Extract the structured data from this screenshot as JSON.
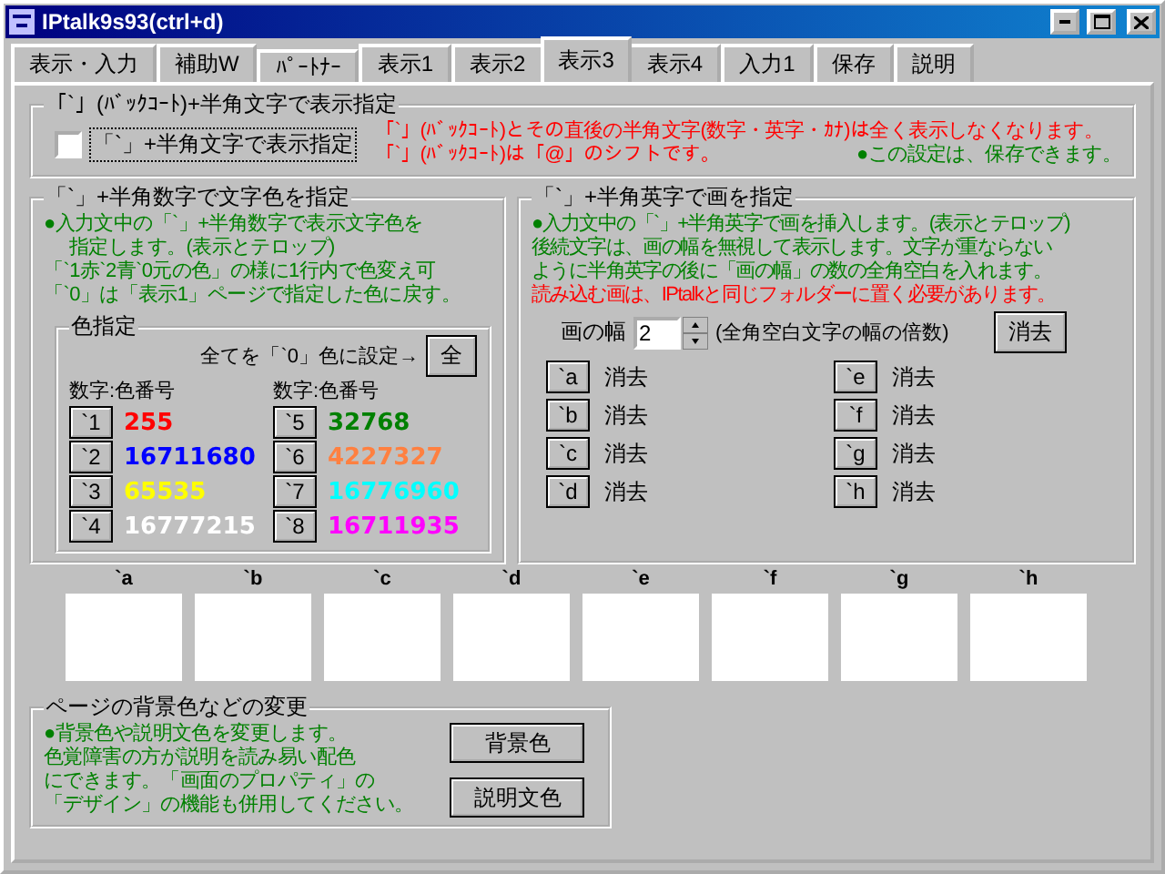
{
  "window": {
    "title": "IPtalk9s93(ctrl+d)"
  },
  "tabs": [
    {
      "label": "表示・入力",
      "selected": false
    },
    {
      "label": "補助W",
      "selected": false
    },
    {
      "label": "ﾊﾟｰﾄﾅｰ",
      "selected": false
    },
    {
      "label": "表示1",
      "selected": false
    },
    {
      "label": "表示2",
      "selected": false
    },
    {
      "label": "表示3",
      "selected": true
    },
    {
      "label": "表示4",
      "selected": false
    },
    {
      "label": "入力1",
      "selected": false
    },
    {
      "label": "保存",
      "selected": false
    },
    {
      "label": "説明",
      "selected": false
    }
  ],
  "display_group": {
    "title": "「`」(ﾊﾞｯｸｺｰﾄ)+半角文字で表示指定",
    "checkbox": {
      "label": "「`」+半角文字で表示指定",
      "checked": false
    },
    "notes": [
      {
        "text": "「`」(ﾊﾞｯｸｺｰﾄ)とその直後の半角文字(数字・英字・ｶﾅ)は全く表示しなくなります。",
        "kind": "warning"
      },
      {
        "text": "「`」(ﾊﾞｯｸｺｰﾄ)は「@」のシフトです。",
        "kind": "warning"
      },
      {
        "text": "●この設定は、保存できます。",
        "kind": "info"
      }
    ]
  },
  "color_group": {
    "title": "「`」+半角数字で文字色を指定",
    "lines": [
      {
        "text": "●入力文中の「`」+半角数字で表示文字色を",
        "kind": "info"
      },
      {
        "text": "指定します。(表示とテロップ)",
        "kind": "info"
      },
      {
        "text": "「`1赤`2青`0元の色」の様に1行内で色変え可",
        "kind": "info"
      },
      {
        "text": "「`0」は「表示1」ページで指定した色に戻す。",
        "kind": "info"
      }
    ],
    "palette": {
      "title": "色指定",
      "reset_label": "全てを「`0」色に設定→",
      "reset_button": "全",
      "headers": [
        "数字:色番号",
        "数字:色番号"
      ],
      "colors": [
        {
          "key": "`1",
          "value": "255",
          "color": "#ff0000"
        },
        {
          "key": "`2",
          "value": "16711680",
          "color": "#0000ff"
        },
        {
          "key": "`3",
          "value": "65535",
          "color": "#ffff00"
        },
        {
          "key": "`4",
          "value": "16777215",
          "color": "#ffffff"
        },
        {
          "key": "`5",
          "value": "32768",
          "color": "#008000"
        },
        {
          "key": "`6",
          "value": "4227327",
          "color": "#ff8040"
        },
        {
          "key": "`7",
          "value": "16776960",
          "color": "#00ffff"
        },
        {
          "key": "`8",
          "value": "16711935",
          "color": "#ff00ff"
        }
      ]
    }
  },
  "image_group": {
    "title": "「`」+半角英字で画を指定",
    "lines": [
      {
        "text": "●入力文中の「`」+半角英字で画を挿入します。(表示とテロップ)",
        "kind": "info"
      },
      {
        "text": "後続文字は、画の幅を無視して表示します。文字が重ならない",
        "kind": "info"
      },
      {
        "text": "ように半角英字の後に「画の幅」の数の全角空白を入れます。",
        "kind": "info"
      },
      {
        "text": "読み込む画は、IPtalkと同じフォルダーに置く必要があります。",
        "kind": "warning"
      }
    ],
    "width_label": "画の幅",
    "width_value": "2",
    "width_hint": "(全角空白文字の幅の倍数)",
    "clear_button": "消去",
    "images": [
      {
        "key": "`a",
        "status": "消去"
      },
      {
        "key": "`b",
        "status": "消去"
      },
      {
        "key": "`c",
        "status": "消去"
      },
      {
        "key": "`d",
        "status": "消去"
      },
      {
        "key": "`e",
        "status": "消去"
      },
      {
        "key": "`f",
        "status": "消去"
      },
      {
        "key": "`g",
        "status": "消去"
      },
      {
        "key": "`h",
        "status": "消去"
      }
    ]
  },
  "image_slots": [
    "`a",
    "`b",
    "`c",
    "`d",
    "`e",
    "`f",
    "`g",
    "`h"
  ],
  "background_group": {
    "title": "ページの背景色などの変更",
    "lines": [
      {
        "text": "●背景色や説明文色を変更します。",
        "kind": "info"
      },
      {
        "text": "色覚障害の方が説明を読み易い配色",
        "kind": "info"
      },
      {
        "text": "にできます。「画面のプロパティ」の",
        "kind": "info"
      },
      {
        "text": "「デザイン」の機能も併用してください。",
        "kind": "info"
      }
    ],
    "buttons": [
      "背景色",
      "説明文色"
    ]
  }
}
